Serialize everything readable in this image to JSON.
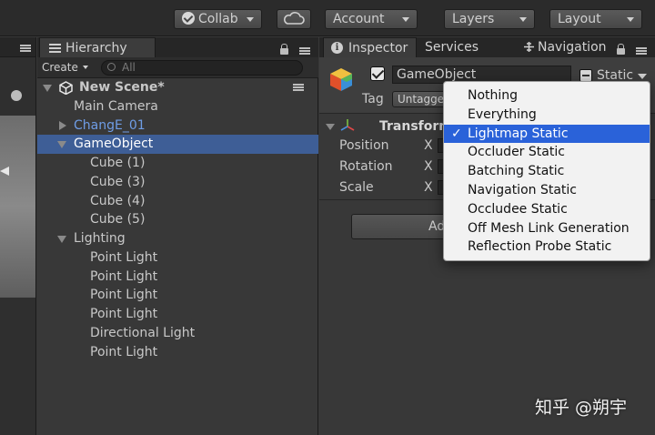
{
  "toolbar": {
    "collab": "Collab",
    "account": "Account",
    "layers": "Layers",
    "layout": "Layout"
  },
  "hierarchy": {
    "tab": "Hierarchy",
    "create": "Create",
    "search_placeholder": "All",
    "rows": [
      {
        "label": "New Scene*",
        "depth": 0,
        "expander": "down",
        "style": "scene"
      },
      {
        "label": "Main Camera",
        "depth": 1,
        "expander": "none",
        "style": "normal"
      },
      {
        "label": "ChangE_01",
        "depth": 1,
        "expander": "right",
        "style": "prefab"
      },
      {
        "label": "GameObject",
        "depth": 1,
        "expander": "down",
        "style": "selected"
      },
      {
        "label": "Cube (1)",
        "depth": 2,
        "expander": "none",
        "style": "normal"
      },
      {
        "label": "Cube (3)",
        "depth": 2,
        "expander": "none",
        "style": "normal"
      },
      {
        "label": "Cube (4)",
        "depth": 2,
        "expander": "none",
        "style": "normal"
      },
      {
        "label": "Cube (5)",
        "depth": 2,
        "expander": "none",
        "style": "normal"
      },
      {
        "label": "Lighting",
        "depth": 1,
        "expander": "down",
        "style": "normal"
      },
      {
        "label": "Point Light",
        "depth": 2,
        "expander": "none",
        "style": "normal"
      },
      {
        "label": "Point Light",
        "depth": 2,
        "expander": "none",
        "style": "normal"
      },
      {
        "label": "Point Light",
        "depth": 2,
        "expander": "none",
        "style": "normal"
      },
      {
        "label": "Point Light",
        "depth": 2,
        "expander": "none",
        "style": "normal"
      },
      {
        "label": "Directional Light",
        "depth": 2,
        "expander": "none",
        "style": "normal"
      },
      {
        "label": "Point Light",
        "depth": 2,
        "expander": "none",
        "style": "normal"
      }
    ]
  },
  "inspector": {
    "tabs": {
      "inspector": "Inspector",
      "services": "Services",
      "navigation": "Navigation"
    },
    "object_name": "GameObject",
    "static_label": "Static",
    "tag_label": "Tag",
    "tag_value": "Untagged",
    "component_title": "Transform",
    "props": {
      "position": "Position",
      "rotation": "Rotation",
      "scale": "Scale",
      "axis_x": "X"
    },
    "add_component": "Ad"
  },
  "static_menu": {
    "options": [
      {
        "label": "Nothing",
        "checked": false
      },
      {
        "label": "Everything",
        "checked": false
      },
      {
        "label": "Lightmap Static",
        "checked": true
      },
      {
        "label": "Occluder Static",
        "checked": false
      },
      {
        "label": "Batching Static",
        "checked": false
      },
      {
        "label": "Navigation Static",
        "checked": false
      },
      {
        "label": "Occludee Static",
        "checked": false
      },
      {
        "label": "Off Mesh Link Generation",
        "checked": false
      },
      {
        "label": "Reflection Probe Static",
        "checked": false
      }
    ],
    "check_glyph": "✓"
  },
  "watermark": "知乎 @朔宇",
  "colors": {
    "selection": "#3e5e96",
    "prefab_text": "#6f9de6",
    "menu_highlight": "#2a62d9"
  }
}
